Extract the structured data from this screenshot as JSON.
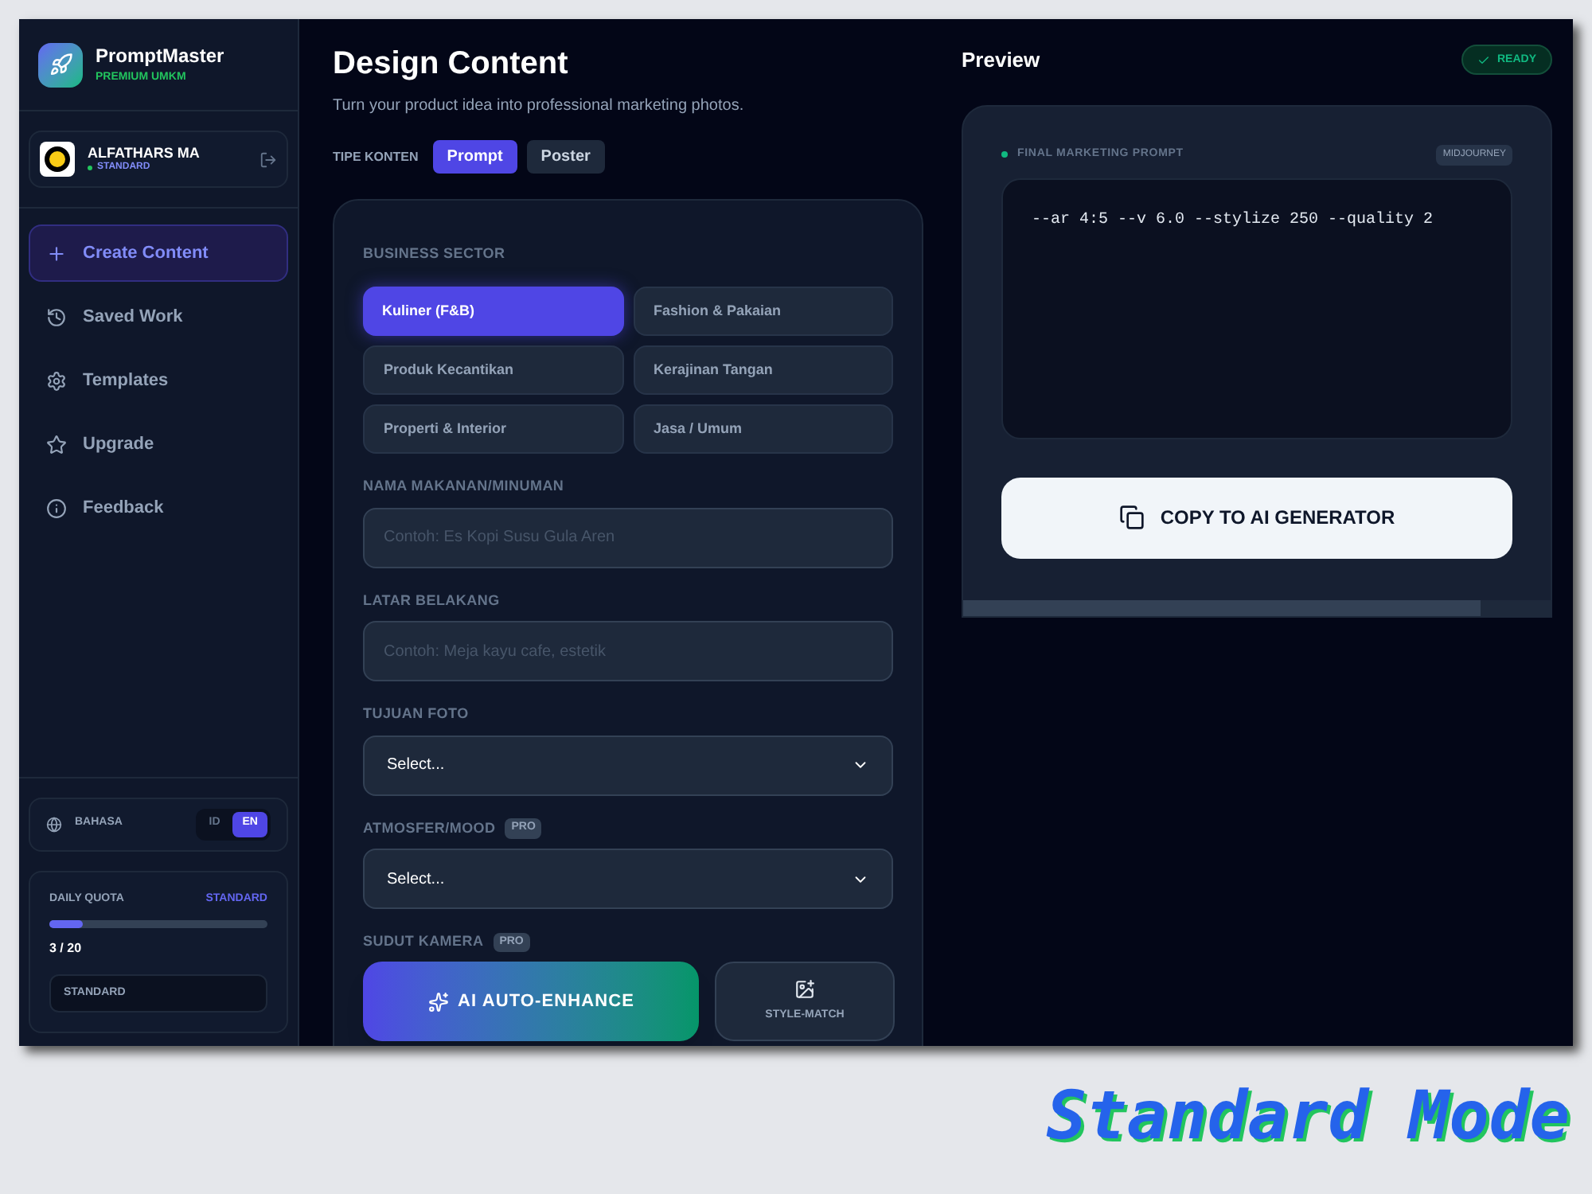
{
  "sidebar": {
    "app_name": "PromptMaster",
    "app_tier": "PREMIUM UMKM",
    "user": {
      "name": "ALFATHARS MA",
      "plan": "STANDARD"
    },
    "nav": [
      {
        "label": "Create Content",
        "selected": true
      },
      {
        "label": "Saved Work",
        "selected": false
      },
      {
        "label": "Templates",
        "selected": false
      },
      {
        "label": "Upgrade",
        "selected": false
      },
      {
        "label": "Feedback",
        "selected": false
      }
    ],
    "language": {
      "label": "BAHASA",
      "options": [
        {
          "label": "ID",
          "selected": false
        },
        {
          "label": "EN",
          "selected": true
        }
      ]
    },
    "quota": {
      "label": "DAILY QUOTA",
      "plan": "STANDARD",
      "level": 0.15,
      "count": "3 / 20",
      "tier": "STANDARD"
    }
  },
  "main": {
    "title": "Design Content",
    "subtitle": "Turn your product idea into professional marketing photos.",
    "content_type": {
      "label": "TIPE KONTEN",
      "tabs": [
        {
          "label": "Prompt",
          "selected": true
        },
        {
          "label": "Poster",
          "selected": false
        }
      ]
    },
    "form": {
      "sector_label": "BUSINESS SECTOR",
      "sectors": [
        {
          "label": "Kuliner (F&B)",
          "selected": true
        },
        {
          "label": "Fashion & Pakaian",
          "selected": false
        },
        {
          "label": "Produk Kecantikan",
          "selected": false
        },
        {
          "label": "Kerajinan Tangan",
          "selected": false
        },
        {
          "label": "Properti & Interior",
          "selected": false
        },
        {
          "label": "Jasa / Umum",
          "selected": false
        }
      ],
      "fields": [
        {
          "kind": "text",
          "label": "NAMA MAKANAN/MINUMAN",
          "placeholder": "Contoh: Es Kopi Susu Gula Aren"
        },
        {
          "kind": "text",
          "label": "LATAR BELAKANG",
          "placeholder": "Contoh: Meja kayu cafe, estetik"
        },
        {
          "kind": "select",
          "label": "TUJUAN FOTO",
          "value": "Select..."
        },
        {
          "kind": "select",
          "label": "ATMOSFER/MOOD",
          "badge": "PRO",
          "value": "Select..."
        },
        {
          "kind": "heading",
          "label": "SUDUT KAMERA",
          "badge": "PRO"
        }
      ]
    },
    "actions": {
      "enhance": "AI AUTO-ENHANCE",
      "style_match": "STYLE-MATCH"
    }
  },
  "preview": {
    "title": "Preview",
    "status": "READY",
    "prompt_label": "FINAL MARKETING PROMPT",
    "engine": "MIDJOURNEY",
    "prompt": "--ar 4:5 --v 6.0 --stylize 250 --quality 2",
    "copy_button": "COPY TO AI GENERATOR"
  },
  "caption": "Standard Mode"
}
